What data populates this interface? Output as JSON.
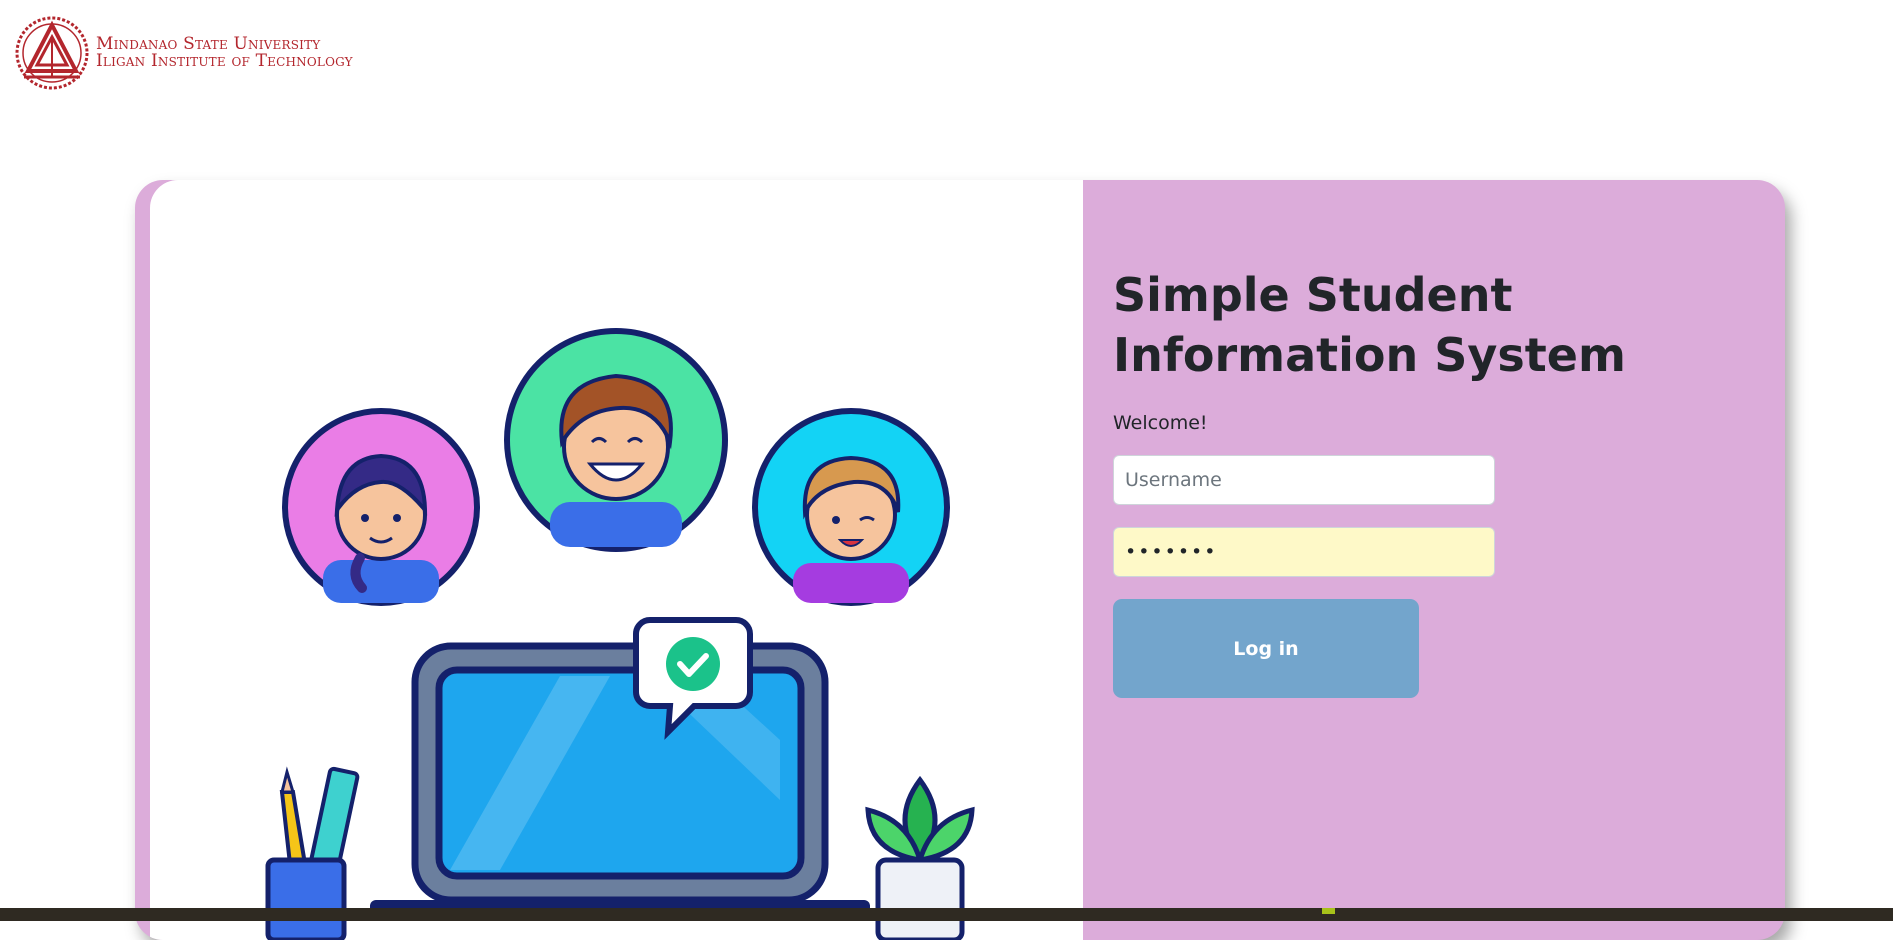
{
  "logo": {
    "line1": "Mindanao State University",
    "line2": "Iligan Institute of Technology",
    "color": "#b3262d"
  },
  "login": {
    "title": "Simple Student Information System",
    "welcome": "Welcome!",
    "username_placeholder": "Username",
    "username_value": "",
    "password_value": "secret1",
    "button_label": "Log in"
  },
  "colors": {
    "panel": "#dcacda",
    "button": "#73a5cc",
    "autofill": "#fef9c8",
    "text": "#212529"
  },
  "illustration": {
    "icons": [
      "avatar-girl-icon",
      "avatar-boy-icon",
      "avatar-kid-icon",
      "laptop-icon",
      "checkmark-bubble-icon",
      "pencil-cup-icon",
      "plant-icon"
    ]
  }
}
